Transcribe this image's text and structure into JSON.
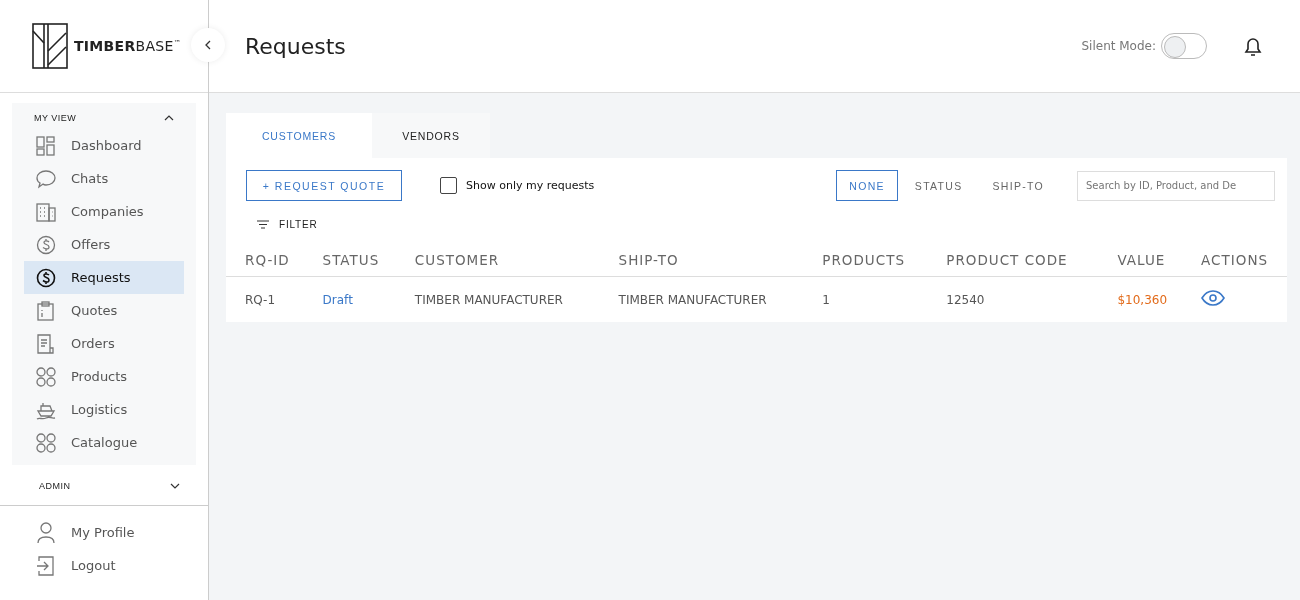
{
  "brand": {
    "logo": "**TIMBER**BASE$^{™}$"
  },
  "page_title": "Requests",
  "silent_mode": {
    "label": "Silent Mode:",
    "on": false
  },
  "sidebar": {
    "sections": [
      {
        "title": "MY VIEW",
        "expanded": true,
        "items": [
          {
            "label": "Dashboard",
            "kind": "dashboard",
            "selected": false
          },
          {
            "label": "Chats",
            "kind": "chat",
            "selected": false
          },
          {
            "label": "Companies",
            "kind": "building",
            "selected": false
          },
          {
            "label": "Offers",
            "kind": "dollar",
            "selected": false
          },
          {
            "label": "Requests",
            "kind": "dollar",
            "selected": true
          },
          {
            "label": "Quotes",
            "kind": "clipboard",
            "selected": false
          },
          {
            "label": "Orders",
            "kind": "document",
            "selected": false
          },
          {
            "label": "Products",
            "kind": "circles",
            "selected": false
          },
          {
            "label": "Logistics",
            "kind": "ship",
            "selected": false
          },
          {
            "label": "Catalogue",
            "kind": "circles",
            "selected": false
          }
        ]
      },
      {
        "title": "ADMIN",
        "expanded": false
      }
    ],
    "footer_items": [
      {
        "label": "My Profile",
        "kind": "person"
      },
      {
        "label": "Logout",
        "kind": "logout"
      }
    ]
  },
  "tabs": [
    {
      "label": "CUSTOMERS",
      "selected": true
    },
    {
      "label": "VENDORS",
      "selected": false
    }
  ],
  "toolbar": {
    "request_button": "+ REQUEST QUOTE",
    "only_mine": {
      "label": "Show only my requests",
      "checked": false
    },
    "group_by": [
      {
        "label": "NONE",
        "selected": true
      },
      {
        "label": "STATUS",
        "selected": false
      },
      {
        "label": "SHIP-TO",
        "selected": false
      }
    ],
    "search": {
      "placeholder": "Search by ID, Product, and De"
    },
    "filter": "FILTER"
  },
  "table": {
    "columns": [
      "RQ-ID",
      "STATUS",
      "CUSTOMER",
      "SHIP-TO",
      "PRODUCTS",
      "PRODUCT CODE",
      "VALUE",
      "ACTIONS"
    ],
    "rows": [
      {
        "id": "RQ-1",
        "status": "Draft",
        "customer": "TIMBER MANUFACTURER",
        "ship_to": "TIMBER MANUFACTURER",
        "products": "1",
        "product_code": "12540",
        "value": "$10,360"
      }
    ]
  }
}
